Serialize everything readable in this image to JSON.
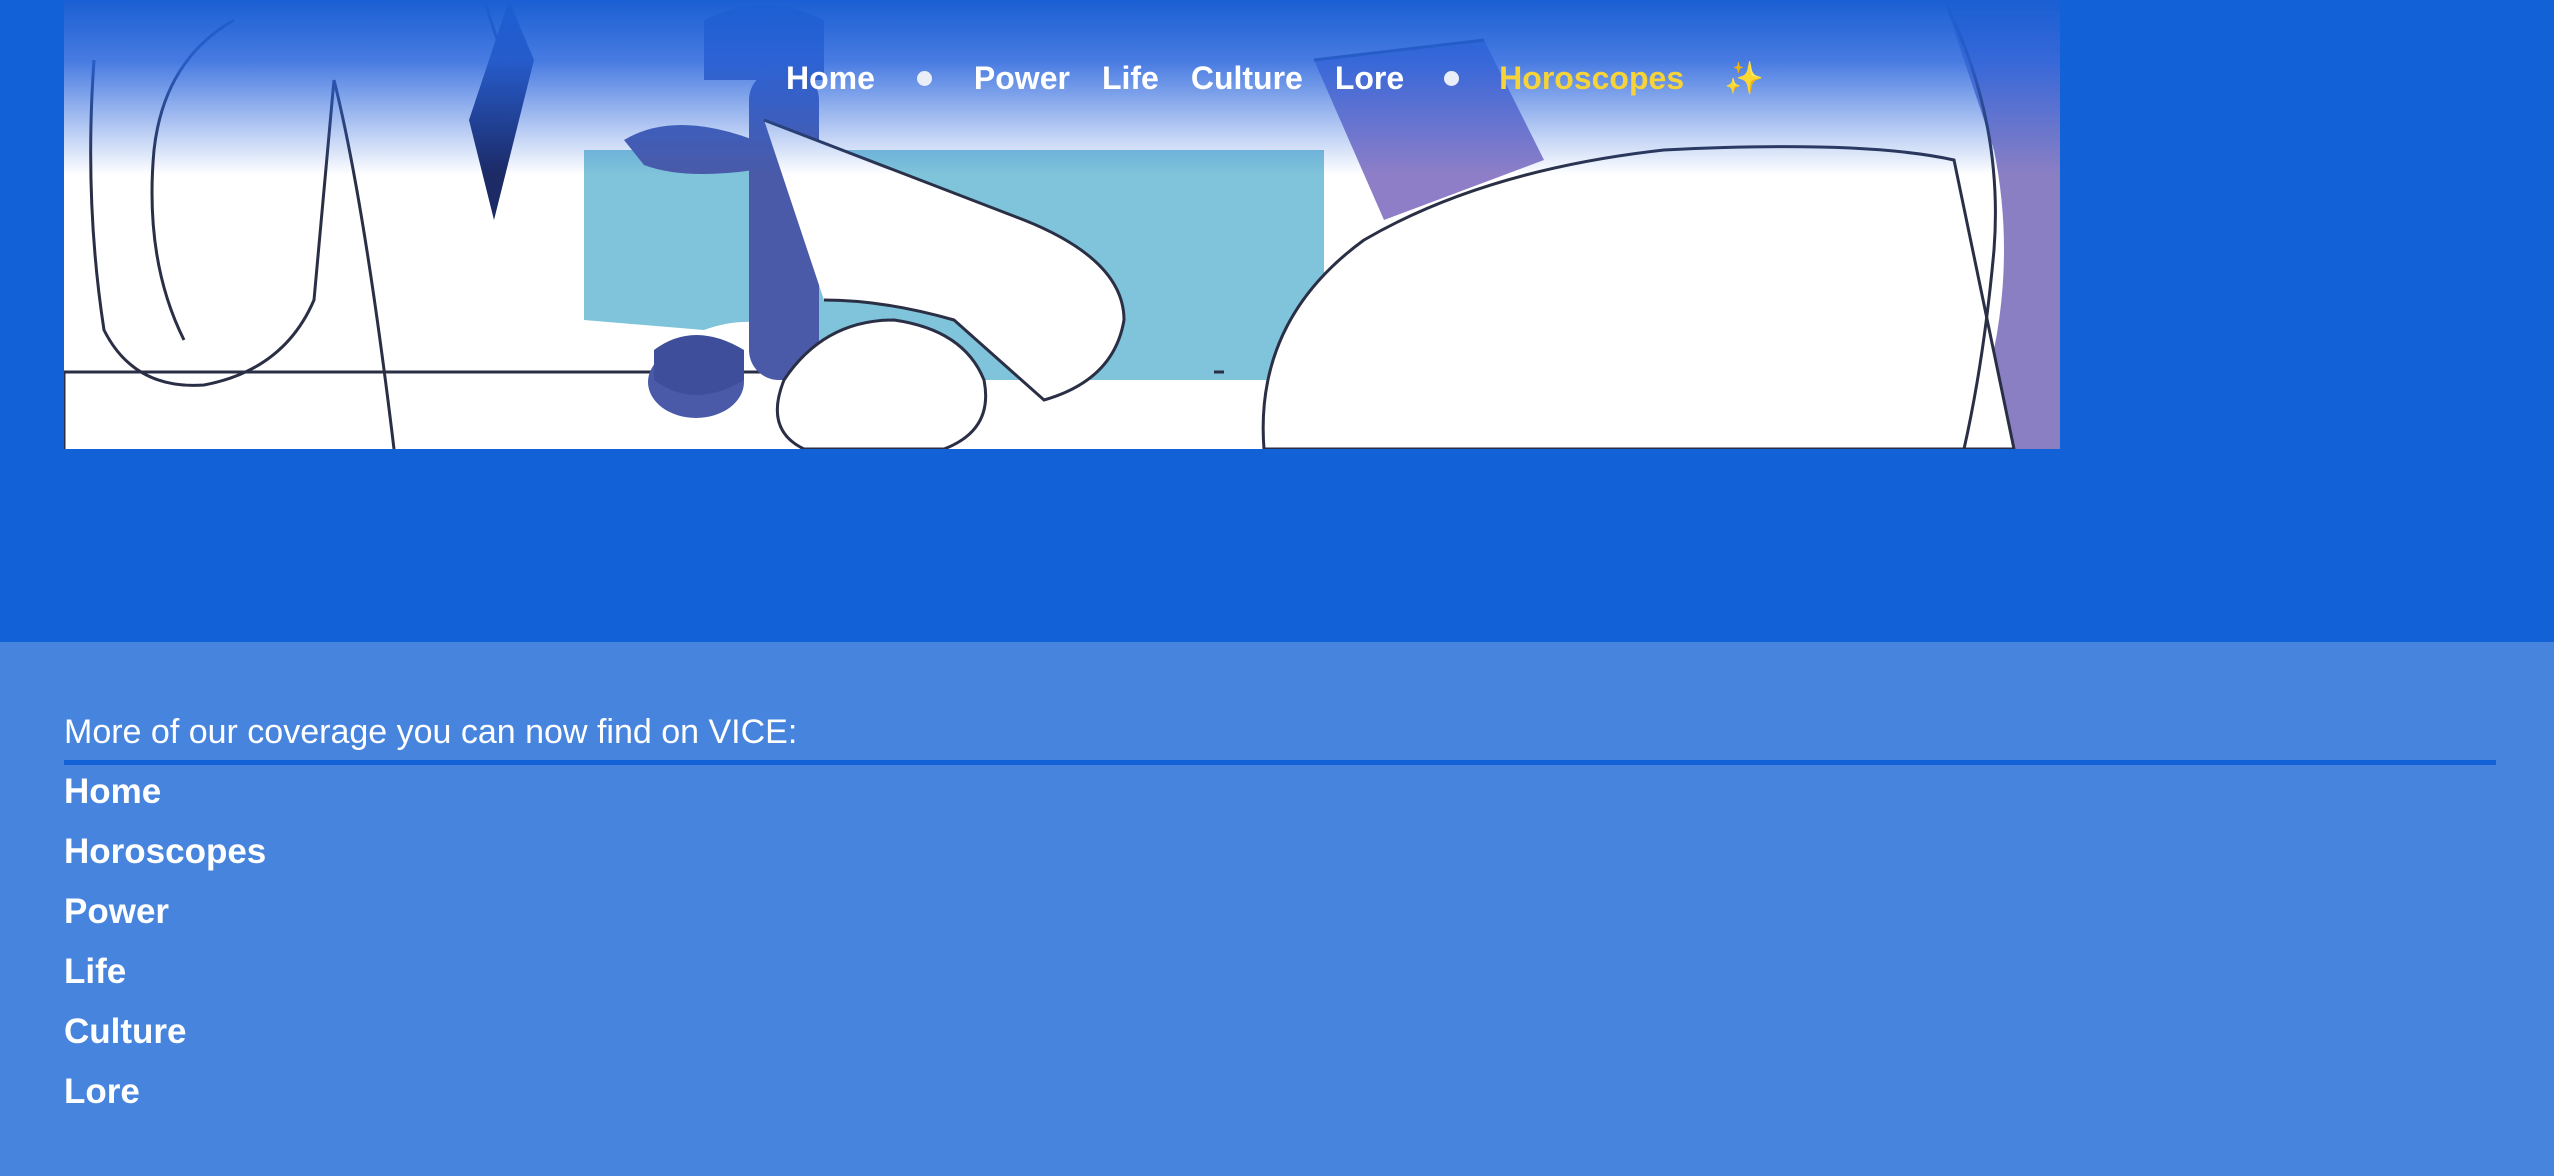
{
  "nav": {
    "items": [
      {
        "label": "Home",
        "type": "link"
      },
      {
        "type": "dot"
      },
      {
        "label": "Power",
        "type": "link"
      },
      {
        "label": "Life",
        "type": "link"
      },
      {
        "label": "Culture",
        "type": "link"
      },
      {
        "label": "Lore",
        "type": "link"
      },
      {
        "type": "dot"
      },
      {
        "label": "Horoscopes",
        "type": "link",
        "active": true
      },
      {
        "label": "✨",
        "type": "sparkle"
      }
    ]
  },
  "footer": {
    "heading": "More of our coverage you can now find on VICE:",
    "links": [
      "Home",
      "Horoscopes",
      "Power",
      "Life",
      "Culture",
      "Lore"
    ]
  },
  "colors": {
    "page_background": "#1261d6",
    "footer_background": "#4784de",
    "accent_yellow": "#f7d33a",
    "text": "#ffffff"
  },
  "icons": {
    "nav_separator": "dot-icon",
    "sparkle": "sparkles-icon"
  }
}
